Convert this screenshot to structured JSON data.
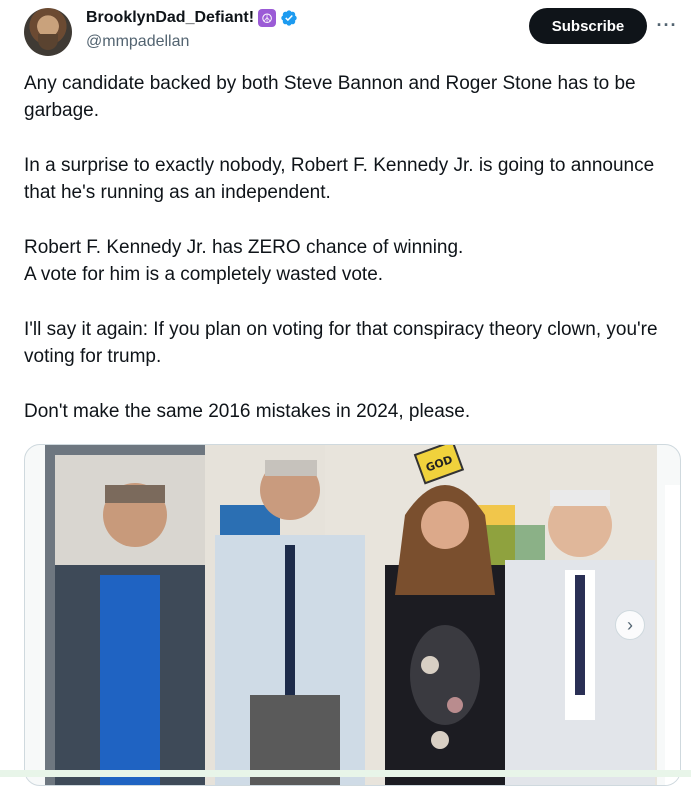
{
  "author": {
    "display_name": "BrooklynDad_Defiant!",
    "emoji": "☮",
    "handle": "@mmpadellan",
    "verified_icon": "verified-badge-icon"
  },
  "actions": {
    "subscribe_label": "Subscribe",
    "more_label": "···"
  },
  "tweet": {
    "paragraphs": [
      "Any candidate backed by both Steve Bannon and Roger Stone has to be garbage.",
      "In a surprise to exactly nobody, Robert F. Kennedy Jr. is going to announce that he's running as an independent.",
      "Robert F. Kennedy Jr. has ZERO chance of winning.\nA vote for him is a completely wasted vote.",
      "I'll say it again: If you plan on voting for that conspiracy theory clown, you're voting for trump.",
      "Don't make the same 2016 mistakes in 2024, please."
    ]
  },
  "media": {
    "next_icon": "chevron-right-icon",
    "next_label": "›",
    "sign_text": "GOD"
  },
  "colors": {
    "accent": "#1d9bf0",
    "text": "#0f1419",
    "muted": "#536471"
  }
}
